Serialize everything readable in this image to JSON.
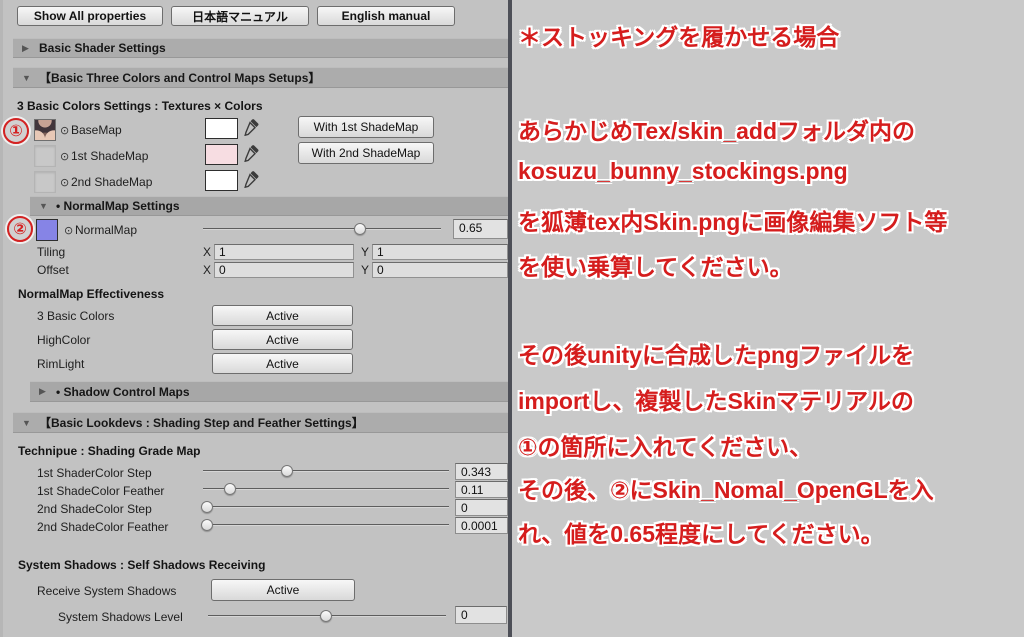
{
  "toolbar": {
    "show_all_properties": "Show All properties",
    "japanese_manual": "日本語マニュアル",
    "english_manual": "English manual"
  },
  "headers": {
    "basic_shader_settings": "Basic Shader Settings",
    "three_colors_setups": "【Basic Three Colors and Control Maps Setups】",
    "normalmap_settings": "• NormalMap Settings",
    "shadow_control_maps": "• Shadow Control Maps",
    "basic_lookdevs": "【Basic Lookdevs : Shading Step and Feather Settings】"
  },
  "labels": {
    "three_colors_sub": "3 Basic Colors Settings : Textures × Colors",
    "normalmap_effectiveness": "NormalMap Effectiveness",
    "technique": "Technipue : Shading Grade Map",
    "system_shadows_heading": "System Shadows : Self Shadows Receiving"
  },
  "icons": {
    "collapsed_arrow": "▶",
    "expanded_arrow": "▼",
    "object_picker": "⊙"
  },
  "maps": [
    {
      "label": "BaseMap",
      "swatch": "#ffffff"
    },
    {
      "label": "1st ShadeMap",
      "swatch": "#f7dde2"
    },
    {
      "label": "2nd ShadeMap",
      "swatch": "#ffffff"
    }
  ],
  "with_buttons": [
    {
      "label": "With 1st ShadeMap"
    },
    {
      "label": "With 2nd ShadeMap"
    }
  ],
  "normalmap": {
    "label": "NormalMap",
    "swatch": "#8684e6",
    "value": "0.65",
    "percent": 66,
    "tiling_label": "Tiling",
    "offset_label": "Offset",
    "axis_x": "X",
    "axis_y": "Y",
    "tiling_x": "1",
    "tiling_y": "1",
    "offset_x": "0",
    "offset_y": "0"
  },
  "effectiveness_rows": [
    {
      "label": "3 Basic Colors",
      "button": "Active"
    },
    {
      "label": "HighColor",
      "button": "Active"
    },
    {
      "label": "RimLight",
      "button": "Active"
    }
  ],
  "shading_sliders": [
    {
      "label": "1st ShaderColor Step",
      "value": "0.343",
      "percent": 34.3
    },
    {
      "label": "1st ShadeColor Feather",
      "value": "0.11",
      "percent": 11
    },
    {
      "label": "2nd ShadeColor Step",
      "value": "0",
      "percent": 1.5
    },
    {
      "label": "2nd ShadeColor Feather",
      "value": "0.0001",
      "percent": 1.5
    }
  ],
  "system_shadows": {
    "receive_label": "Receive System Shadows",
    "receive_button": "Active",
    "level_label": "System Shadows Level",
    "level_value": "0",
    "level_percent": 49.5
  },
  "callouts": {
    "one": "①",
    "two": "②"
  },
  "note": {
    "color": "#d51d1d",
    "lines": [
      "＊ストッキングを履かせる場合",
      "あらかじめTex/skin_addフォルダ内の",
      "kosuzu_bunny_stockings.png",
      "を狐薄tex内Skin.pngに画像編集ソフト等",
      "を使い乗算してください。",
      "その後unityに合成したpngファイルを",
      "importし、複製したSkinマテリアルの",
      "①の箇所に入れてください、",
      "その後、②にSkin_Nomal_OpenGLを入",
      "れ、値を0.65程度にしてください。"
    ]
  }
}
